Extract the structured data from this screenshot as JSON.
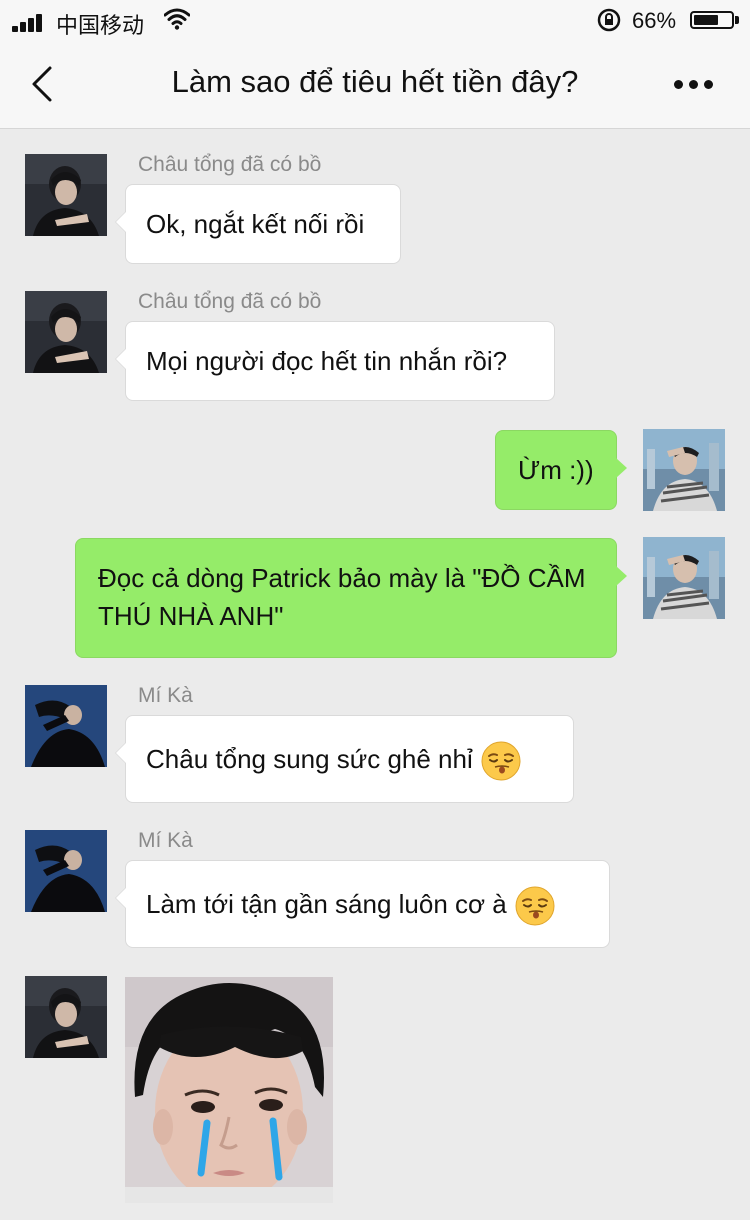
{
  "status_bar": {
    "carrier": "中国移动",
    "battery_percent": "66%",
    "battery_level": 0.66
  },
  "nav": {
    "title": "Làm sao để tiêu hết tiền đây?",
    "back_icon": "chevron-left-icon",
    "more_icon": "more-dots-icon"
  },
  "messages": [
    {
      "sender": "Châu tổng đã có bồ",
      "text": "Ok, ngắt kết nối rồi"
    },
    {
      "sender": "Châu tổng đã có bồ",
      "text": "Mọi người đọc hết tin nhắn rồi?"
    },
    {
      "sender": "",
      "text": "Ừm :))"
    },
    {
      "sender": "",
      "text": "Đọc cả dòng Patrick bảo mày là \"ĐỒ CẦM THÚ NHÀ ANH\""
    },
    {
      "sender": "Mí Kà",
      "text": "Châu tổng sung sức ghê nhỉ"
    },
    {
      "sender": "Mí Kà",
      "text": "Làm tới tận gần sáng luôn cơ à"
    },
    {
      "sender": "",
      "text": ""
    }
  ],
  "colors": {
    "background": "#ebebeb",
    "outgoing_bubble": "#95ec69",
    "incoming_bubble": "#ffffff",
    "sender_name": "#8a8a8a"
  }
}
